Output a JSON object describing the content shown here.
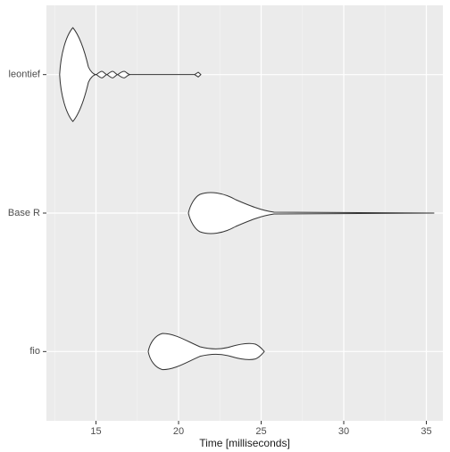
{
  "chart_data": {
    "type": "violin",
    "xlabel": "Time [milliseconds]",
    "ylabel": "",
    "xlim": [
      12,
      36
    ],
    "x_ticks": [
      15,
      20,
      25,
      30,
      35
    ],
    "categories": [
      "leontief",
      "Base R",
      "fio"
    ],
    "series": [
      {
        "name": "leontief",
        "summary": {
          "min": 12.8,
          "q1": 13.2,
          "median": 13.6,
          "q3": 14.0,
          "max": 21.2
        },
        "modes": [
          13.6
        ],
        "tail_bumps": [
          15.3,
          16.0,
          16.7
        ]
      },
      {
        "name": "Base R",
        "summary": {
          "min": 20.6,
          "q1": 22.0,
          "median": 22.8,
          "q3": 25.0,
          "max": 34.5
        },
        "modes": [
          22.8
        ]
      },
      {
        "name": "fio",
        "summary": {
          "min": 18.2,
          "q1": 18.8,
          "median": 19.6,
          "q3": 22.5,
          "max": 25.0
        },
        "modes": [
          19.6,
          24.0
        ]
      }
    ]
  },
  "axis": {
    "x_title": "Time [milliseconds]",
    "x_ticks": [
      "15",
      "20",
      "25",
      "30",
      "35"
    ]
  },
  "y_labels": {
    "leontief": "leontief",
    "baser": "Base R",
    "fio": "fio"
  }
}
